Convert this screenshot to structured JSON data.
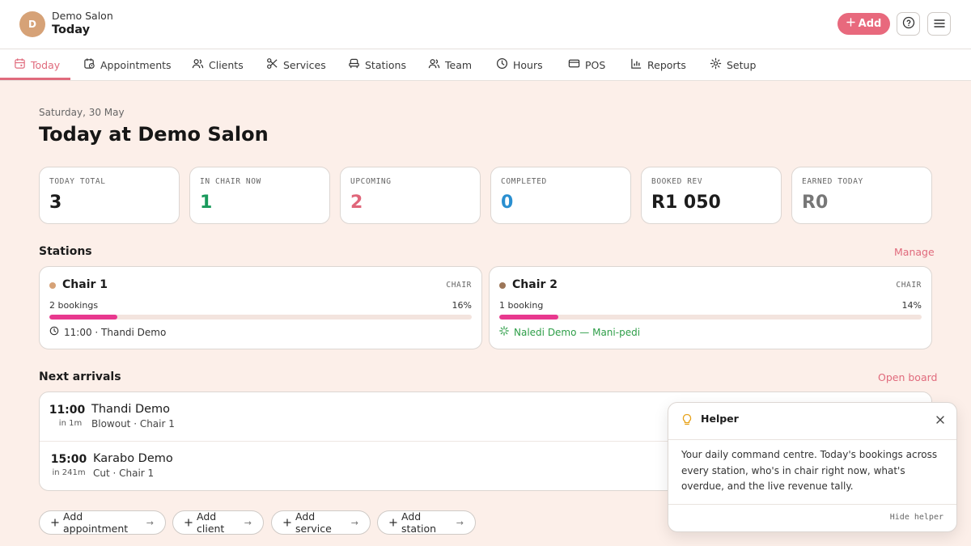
{
  "header": {
    "avatar_initial": "D",
    "salon_name": "Demo Salon",
    "page_name": "Today",
    "add_label": "Add"
  },
  "nav": {
    "tabs": [
      {
        "label": "Today",
        "icon": "calendar-today-icon",
        "active": true
      },
      {
        "label": "Appointments",
        "icon": "calendar-clock-icon"
      },
      {
        "label": "Clients",
        "icon": "users-icon"
      },
      {
        "label": "Services",
        "icon": "scissors-icon"
      },
      {
        "label": "Stations",
        "icon": "chair-icon"
      },
      {
        "label": "Team",
        "icon": "team-icon"
      },
      {
        "label": "Hours",
        "icon": "clock-icon"
      },
      {
        "label": "POS",
        "icon": "credit-card-icon"
      },
      {
        "label": "Reports",
        "icon": "bar-chart-icon"
      },
      {
        "label": "Setup",
        "icon": "gear-icon"
      }
    ]
  },
  "main": {
    "date": "Saturday, 30 May",
    "title": "Today at Demo Salon"
  },
  "stats": [
    {
      "label": "TODAY TOTAL",
      "value": "3",
      "color": "#1c1c1c"
    },
    {
      "label": "IN CHAIR NOW",
      "value": "1",
      "color": "#1a9a5c"
    },
    {
      "label": "UPCOMING",
      "value": "2",
      "color": "#e0667a"
    },
    {
      "label": "COMPLETED",
      "value": "0",
      "color": "#2a8fd0"
    },
    {
      "label": "BOOKED REV",
      "value": "R1 050",
      "color": "#1c1c1c"
    },
    {
      "label": "EARNED TODAY",
      "value": "R0",
      "color": "#777777"
    }
  ],
  "stations": {
    "title": "Stations",
    "manage_label": "Manage",
    "items": [
      {
        "name": "Chair 1",
        "type": "CHAIR",
        "bookings": "2 bookings",
        "utilization_pct": 16,
        "utilization_label": "16%",
        "next": "11:00 · Thandi Demo",
        "dot_color": "#d6a277"
      },
      {
        "name": "Chair 2",
        "type": "CHAIR",
        "bookings": "1 booking",
        "utilization_pct": 14,
        "utilization_label": "14%",
        "next": "Naledi Demo — Mani-pedi",
        "dot_color": "#9c7658"
      }
    ]
  },
  "arrivals": {
    "title": "Next arrivals",
    "open_board_label": "Open board",
    "items": [
      {
        "time": "11:00",
        "relative": "in 1m",
        "name": "Thandi Demo",
        "detail": "Blowout · Chair 1"
      },
      {
        "time": "15:00",
        "relative": "in 241m",
        "name": "Karabo Demo",
        "detail": "Cut · Chair 1"
      }
    ]
  },
  "quick_actions": [
    {
      "label": "Add appointment"
    },
    {
      "label": "Add client"
    },
    {
      "label": "Add service"
    },
    {
      "label": "Add station"
    }
  ],
  "helper": {
    "title": "Helper",
    "body": "Your daily command centre. Today's bookings across every station, who's in chair right now, what's overdue, and the live revenue tally.",
    "hide_label": "Hide helper"
  },
  "colors": {
    "accent": "#e8697d",
    "background": "#fcefe9",
    "progress": "#e8388e"
  }
}
